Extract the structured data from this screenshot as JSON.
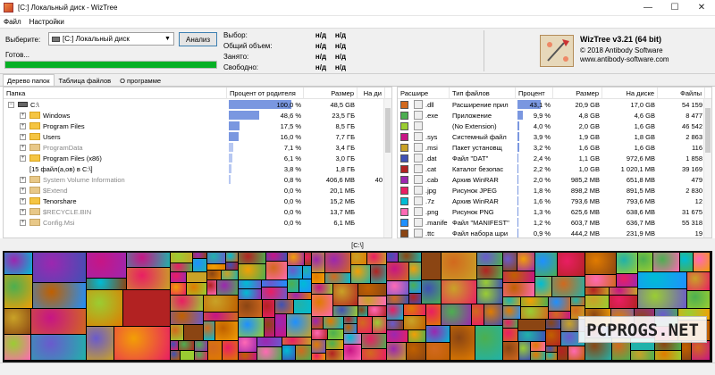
{
  "window": {
    "title": "[C:] Локальный диск - WizTree",
    "minimize_glyph": "—",
    "maximize_glyph": "☐",
    "close_glyph": "✕"
  },
  "menu": [
    "Файл",
    "Настройки"
  ],
  "top": {
    "select_label": "Выберите:",
    "drive_value": "[C:] Локальный диск",
    "dropdown_glyph": "▼",
    "analyze_label": "Анализ",
    "status": "Готов...",
    "progress_fraction": 1.0,
    "stats": [
      {
        "label": "Выбор:",
        "v1": "н/д",
        "v2": "н/д"
      },
      {
        "label": "Общий объем:",
        "v1": "н/д",
        "v2": "н/д"
      },
      {
        "label": "Занято:",
        "v1": "н/д",
        "v2": "н/д"
      },
      {
        "label": "Свободно:",
        "v1": "н/д",
        "v2": "н/д"
      }
    ],
    "brand_name": "WizTree v3.21 (64 bit)",
    "brand_copyright": "© 2018 Antibody Software",
    "brand_site": "www.antibody-software.com"
  },
  "tabs": [
    "Дерево папок",
    "Таблица файлов",
    "О программе"
  ],
  "tree": {
    "columns": [
      "Папка",
      "Процент от родителя",
      "Размер",
      "На ди"
    ],
    "rows": [
      {
        "name": "C:\\",
        "icon": "hdd",
        "expander": "−",
        "percent": "100,0 %",
        "fraction": 1.0,
        "size": "48,5 GB",
        "disk": "",
        "gray": false,
        "selected": true
      },
      {
        "name": "Windows",
        "icon": "folder",
        "expander": "+",
        "percent": "48,6 %",
        "fraction": 0.486,
        "size": "23,5 ГБ",
        "disk": "",
        "gray": false,
        "selected": false
      },
      {
        "name": "Program Files",
        "icon": "folder",
        "expander": "+",
        "percent": "17,5 %",
        "fraction": 0.175,
        "size": "8,5 ГБ",
        "disk": "",
        "gray": false,
        "selected": false
      },
      {
        "name": "Users",
        "icon": "folder",
        "expander": "+",
        "percent": "16,0 %",
        "fraction": 0.16,
        "size": "7,7 ГБ",
        "disk": "",
        "gray": false,
        "selected": false
      },
      {
        "name": "ProgramData",
        "icon": "folder-sys",
        "expander": "+",
        "percent": "7,1 %",
        "fraction": 0.071,
        "size": "3,4 ГБ",
        "disk": "",
        "gray": true,
        "selected": false
      },
      {
        "name": "Program Files (x86)",
        "icon": "folder",
        "expander": "+",
        "percent": "6,1 %",
        "fraction": 0.061,
        "size": "3,0 ГБ",
        "disk": "",
        "gray": false,
        "selected": false
      },
      {
        "name": "[15 файл(а,ов) в C:\\]",
        "icon": "none",
        "expander": "",
        "percent": "3,8 %",
        "fraction": 0.038,
        "size": "1,8 ГБ",
        "disk": "",
        "gray": false,
        "selected": false
      },
      {
        "name": "System Volume Information",
        "icon": "folder-sys",
        "expander": "+",
        "percent": "0,8 %",
        "fraction": 0.008,
        "size": "406,6 MB",
        "disk": "40",
        "gray": true,
        "selected": false
      },
      {
        "name": "$Extend",
        "icon": "folder-sys",
        "expander": "+",
        "percent": "0,0 %",
        "fraction": 0.0,
        "size": "20,1 МБ",
        "disk": "",
        "gray": true,
        "selected": false
      },
      {
        "name": "Tenorshare",
        "icon": "folder",
        "expander": "+",
        "percent": "0,0 %",
        "fraction": 0.0,
        "size": "15,2 МБ",
        "disk": "",
        "gray": false,
        "selected": false
      },
      {
        "name": "$RECYCLE.BIN",
        "icon": "folder-sys",
        "expander": "+",
        "percent": "0,0 %",
        "fraction": 0.0,
        "size": "13,7 МБ",
        "disk": "",
        "gray": true,
        "selected": false
      },
      {
        "name": "Config.Msi",
        "icon": "folder-sys",
        "expander": "+",
        "percent": "0,0 %",
        "fraction": 0.0,
        "size": "6,1 МБ",
        "disk": "",
        "gray": true,
        "selected": false
      }
    ]
  },
  "types": {
    "columns": [
      "Расшире",
      "Тип файлов",
      "Процент",
      "Размер",
      "На диске",
      "Файлы"
    ],
    "rows": [
      {
        "color": "#d2691e",
        "ext": ".dll",
        "type": "Расширение прил",
        "percent": "43,1 %",
        "fraction": 0.431,
        "size": "20,9 GB",
        "disk": "17,0 GB",
        "files": "54 159"
      },
      {
        "color": "#4caf50",
        "ext": ".exe",
        "type": "Приложение",
        "percent": "9,9 %",
        "fraction": 0.099,
        "size": "4,8 GB",
        "disk": "4,6 GB",
        "files": "8 477"
      },
      {
        "color": "#9acd32",
        "ext": "",
        "type": "(No Extension)",
        "percent": "4,0 %",
        "fraction": 0.04,
        "size": "2,0 GB",
        "disk": "1,6 GB",
        "files": "46 542"
      },
      {
        "color": "#c71585",
        "ext": ".sys",
        "type": "Системный файл",
        "percent": "3,9 %",
        "fraction": 0.039,
        "size": "1,9 GB",
        "disk": "1,8 GB",
        "files": "2 863"
      },
      {
        "color": "#c9a227",
        "ext": ".msi",
        "type": "Пакет установщ",
        "percent": "3,2 %",
        "fraction": 0.032,
        "size": "1,6 GB",
        "disk": "1,6 GB",
        "files": "116"
      },
      {
        "color": "#3f51b5",
        "ext": ".dat",
        "type": "Файл \"DAT\"",
        "percent": "2,4 %",
        "fraction": 0.024,
        "size": "1,1 GB",
        "disk": "972,6 MB",
        "files": "1 858"
      },
      {
        "color": "#b22222",
        "ext": ".cat",
        "type": "Каталог безопас",
        "percent": "2,2 %",
        "fraction": 0.022,
        "size": "1,0 GB",
        "disk": "1 020,1 MB",
        "files": "39 169"
      },
      {
        "color": "#9c27b0",
        "ext": ".cab",
        "type": "Архив WinRAR",
        "percent": "2,0 %",
        "fraction": 0.02,
        "size": "985,2 MB",
        "disk": "651,8 MB",
        "files": "479"
      },
      {
        "color": "#e91e63",
        "ext": ".jpg",
        "type": "Рисунок JPEG",
        "percent": "1,8 %",
        "fraction": 0.018,
        "size": "898,2 MB",
        "disk": "891,5 MB",
        "files": "2 830"
      },
      {
        "color": "#00bcd4",
        "ext": ".7z",
        "type": "Архив WinRAR",
        "percent": "1,6 %",
        "fraction": 0.016,
        "size": "793,6 MB",
        "disk": "793,6 MB",
        "files": "12"
      },
      {
        "color": "#ff69b4",
        "ext": ".png",
        "type": "Рисунок PNG",
        "percent": "1,3 %",
        "fraction": 0.013,
        "size": "625,6 MB",
        "disk": "638,6 MB",
        "files": "31 675"
      },
      {
        "color": "#1e90ff",
        "ext": ".manife",
        "type": "Файл \"MANIFEST\"",
        "percent": "1,2 %",
        "fraction": 0.012,
        "size": "603,7 MB",
        "disk": "636,7 MB",
        "files": "55 318"
      },
      {
        "color": "#8b4513",
        "ext": ".ttc",
        "type": "Файл набора шри",
        "percent": "0,9 %",
        "fraction": 0.009,
        "size": "444,2 MB",
        "disk": "231,9 MB",
        "files": "19"
      }
    ]
  },
  "map_label": "[C:\\]",
  "watermark": "PCPROGS.NET",
  "colors": {
    "accent_bar": "#7a97e0",
    "progress": "#06b025"
  }
}
